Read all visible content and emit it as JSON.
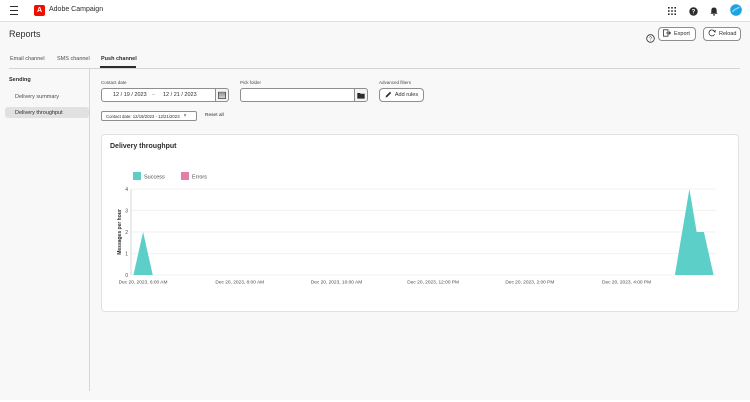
{
  "app": {
    "brand_name": "Adobe Campaign",
    "brand_logo_letter": "A"
  },
  "header": {
    "title": "Reports",
    "export_label": "Export",
    "reload_label": "Reload"
  },
  "tabs": [
    {
      "label": "Email channel",
      "active": false
    },
    {
      "label": "SMS channel",
      "active": false
    },
    {
      "label": "Push channel",
      "active": true
    }
  ],
  "sidebar": {
    "heading": "Sending",
    "items": [
      {
        "label": "Delivery summary",
        "active": false
      },
      {
        "label": "Delivery throughput",
        "active": true
      }
    ]
  },
  "filters": {
    "contact_date_label": "Contact date",
    "date_start": "12 / 19 / 2023",
    "date_separator": "–",
    "date_end": "12 / 21 / 2023",
    "pick_folder_label": "Pick folder",
    "pick_folder_value": "",
    "advanced_filters_label": "Advanced filters",
    "add_rules_label": "Add rules",
    "active_chip": "Contact date: 12/19/2023 - 12/21/2023",
    "reset_all_label": "Reset all"
  },
  "colors": {
    "success": "#5ccfc8",
    "errors": "#e17fa9",
    "accent": "#1473e6"
  },
  "chart_data": {
    "type": "area",
    "title": "Delivery throughput",
    "ylabel": "Messages per hour",
    "xlabel": "",
    "ylim": [
      0,
      4
    ],
    "yticks": [
      0,
      1,
      2,
      3,
      4
    ],
    "xlim_hours": [
      5.75,
      17.85
    ],
    "x_tick_labels": [
      "Dec 20, 2023, 6:00 AM",
      "Dec 20, 2023, 8:00 AM",
      "Dec 20, 2023, 10:00 AM",
      "Dec 20, 2023, 12:00 PM",
      "Dec 20, 2023, 2:00 PM",
      "Dec 20, 2023, 4:00 PM"
    ],
    "x_tick_hours": [
      6,
      8,
      10,
      12,
      14,
      16
    ],
    "legend_position": "top-left",
    "grid": true,
    "series": [
      {
        "name": "Success",
        "color": "#5ccfc8",
        "points": [
          {
            "hour": 5.8,
            "value": 0
          },
          {
            "hour": 6.0,
            "value": 2
          },
          {
            "hour": 6.2,
            "value": 0
          },
          {
            "hour": 17.0,
            "value": 0
          },
          {
            "hour": 17.3,
            "value": 4
          },
          {
            "hour": 17.45,
            "value": 2
          },
          {
            "hour": 17.6,
            "value": 2
          },
          {
            "hour": 17.8,
            "value": 0
          }
        ]
      },
      {
        "name": "Errors",
        "color": "#e17fa9",
        "points": []
      }
    ]
  }
}
